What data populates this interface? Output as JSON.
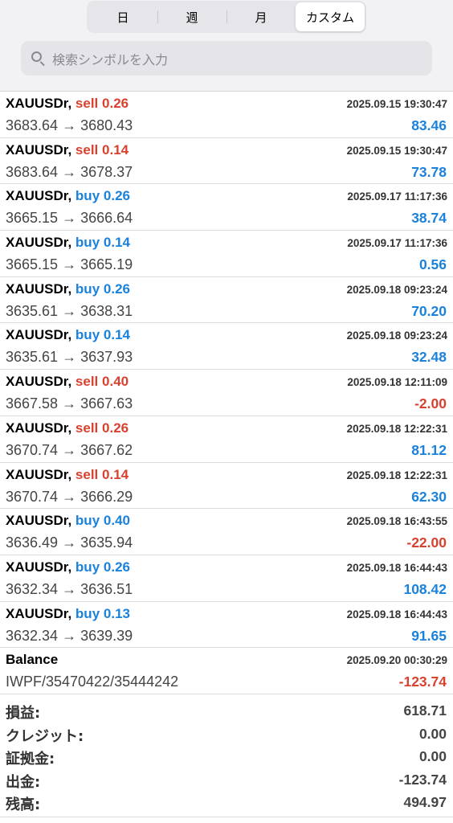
{
  "period_tabs": [
    {
      "label": "日",
      "active": false
    },
    {
      "label": "週",
      "active": false
    },
    {
      "label": "月",
      "active": false
    },
    {
      "label": "カスタム",
      "active": true
    }
  ],
  "search": {
    "placeholder": "検索シンボルを入力"
  },
  "colors": {
    "sell": "#d9412f",
    "buy": "#1a82dc",
    "profit_positive": "#1a82dc",
    "profit_negative": "#d9412f"
  },
  "deals": [
    {
      "symbol": "XAUUSDr,",
      "side": "sell",
      "volume": "0.26",
      "time": "2025.09.15 19:30:47",
      "open": "3683.64",
      "close": "3680.43",
      "profit": "83.46"
    },
    {
      "symbol": "XAUUSDr,",
      "side": "sell",
      "volume": "0.14",
      "time": "2025.09.15 19:30:47",
      "open": "3683.64",
      "close": "3678.37",
      "profit": "73.78"
    },
    {
      "symbol": "XAUUSDr,",
      "side": "buy",
      "volume": "0.26",
      "time": "2025.09.17 11:17:36",
      "open": "3665.15",
      "close": "3666.64",
      "profit": "38.74"
    },
    {
      "symbol": "XAUUSDr,",
      "side": "buy",
      "volume": "0.14",
      "time": "2025.09.17 11:17:36",
      "open": "3665.15",
      "close": "3665.19",
      "profit": "0.56"
    },
    {
      "symbol": "XAUUSDr,",
      "side": "buy",
      "volume": "0.26",
      "time": "2025.09.18 09:23:24",
      "open": "3635.61",
      "close": "3638.31",
      "profit": "70.20"
    },
    {
      "symbol": "XAUUSDr,",
      "side": "buy",
      "volume": "0.14",
      "time": "2025.09.18 09:23:24",
      "open": "3635.61",
      "close": "3637.93",
      "profit": "32.48"
    },
    {
      "symbol": "XAUUSDr,",
      "side": "sell",
      "volume": "0.40",
      "time": "2025.09.18 12:11:09",
      "open": "3667.58",
      "close": "3667.63",
      "profit": "-2.00"
    },
    {
      "symbol": "XAUUSDr,",
      "side": "sell",
      "volume": "0.26",
      "time": "2025.09.18 12:22:31",
      "open": "3670.74",
      "close": "3667.62",
      "profit": "81.12"
    },
    {
      "symbol": "XAUUSDr,",
      "side": "sell",
      "volume": "0.14",
      "time": "2025.09.18 12:22:31",
      "open": "3670.74",
      "close": "3666.29",
      "profit": "62.30"
    },
    {
      "symbol": "XAUUSDr,",
      "side": "buy",
      "volume": "0.40",
      "time": "2025.09.18 16:43:55",
      "open": "3636.49",
      "close": "3635.94",
      "profit": "-22.00"
    },
    {
      "symbol": "XAUUSDr,",
      "side": "buy",
      "volume": "0.26",
      "time": "2025.09.18 16:44:43",
      "open": "3632.34",
      "close": "3636.51",
      "profit": "108.42"
    },
    {
      "symbol": "XAUUSDr,",
      "side": "buy",
      "volume": "0.13",
      "time": "2025.09.18 16:44:43",
      "open": "3632.34",
      "close": "3639.39",
      "profit": "91.65"
    }
  ],
  "balance": {
    "label": "Balance",
    "time": "2025.09.20 00:30:29",
    "comment": "IWPF/35470422/35444242",
    "amount": "-123.74"
  },
  "summary": [
    {
      "label": "損益:",
      "value": "618.71"
    },
    {
      "label": "クレジット:",
      "value": "0.00"
    },
    {
      "label": "証拠金:",
      "value": "0.00"
    },
    {
      "label": "出金:",
      "value": "-123.74"
    },
    {
      "label": "残高:",
      "value": "494.97"
    }
  ],
  "arrow": "→"
}
